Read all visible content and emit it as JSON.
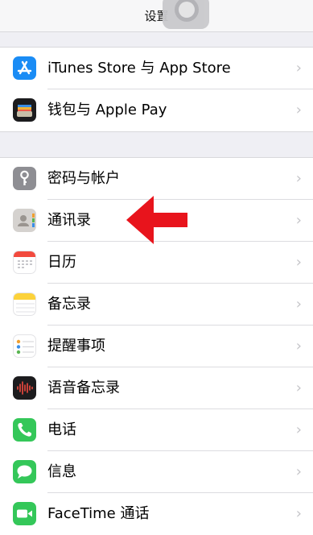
{
  "nav": {
    "title": "设置"
  },
  "group1": [
    {
      "name": "itunes-app-store",
      "label": "iTunes Store 与 App Store",
      "icon": "app-store-icon",
      "color": "#1a8cf5"
    },
    {
      "name": "wallet-apple-pay",
      "label": "钱包与 Apple Pay",
      "icon": "wallet-icon",
      "color": "#1c1c1e"
    }
  ],
  "group2": [
    {
      "name": "passwords-accounts",
      "label": "密码与帐户",
      "icon": "key-icon",
      "color": "#8e8e93"
    },
    {
      "name": "contacts",
      "label": "通讯录",
      "icon": "contacts-icon",
      "color": "#d5d2cf"
    },
    {
      "name": "calendar",
      "label": "日历",
      "icon": "calendar-icon",
      "color": "#ffffff"
    },
    {
      "name": "notes",
      "label": "备忘录",
      "icon": "notes-icon",
      "color": "#ffffff"
    },
    {
      "name": "reminders",
      "label": "提醒事项",
      "icon": "reminders-icon",
      "color": "#ffffff"
    },
    {
      "name": "voice-memos",
      "label": "语音备忘录",
      "icon": "voice-memos-icon",
      "color": "#1c1c1e"
    },
    {
      "name": "phone",
      "label": "电话",
      "icon": "phone-icon",
      "color": "#34c759"
    },
    {
      "name": "messages",
      "label": "信息",
      "icon": "messages-icon",
      "color": "#34c759"
    },
    {
      "name": "facetime",
      "label": "FaceTime 通话",
      "icon": "facetime-icon",
      "color": "#34c759"
    }
  ],
  "chevron": "›",
  "annotation": {
    "arrow_color": "#e8141c"
  }
}
